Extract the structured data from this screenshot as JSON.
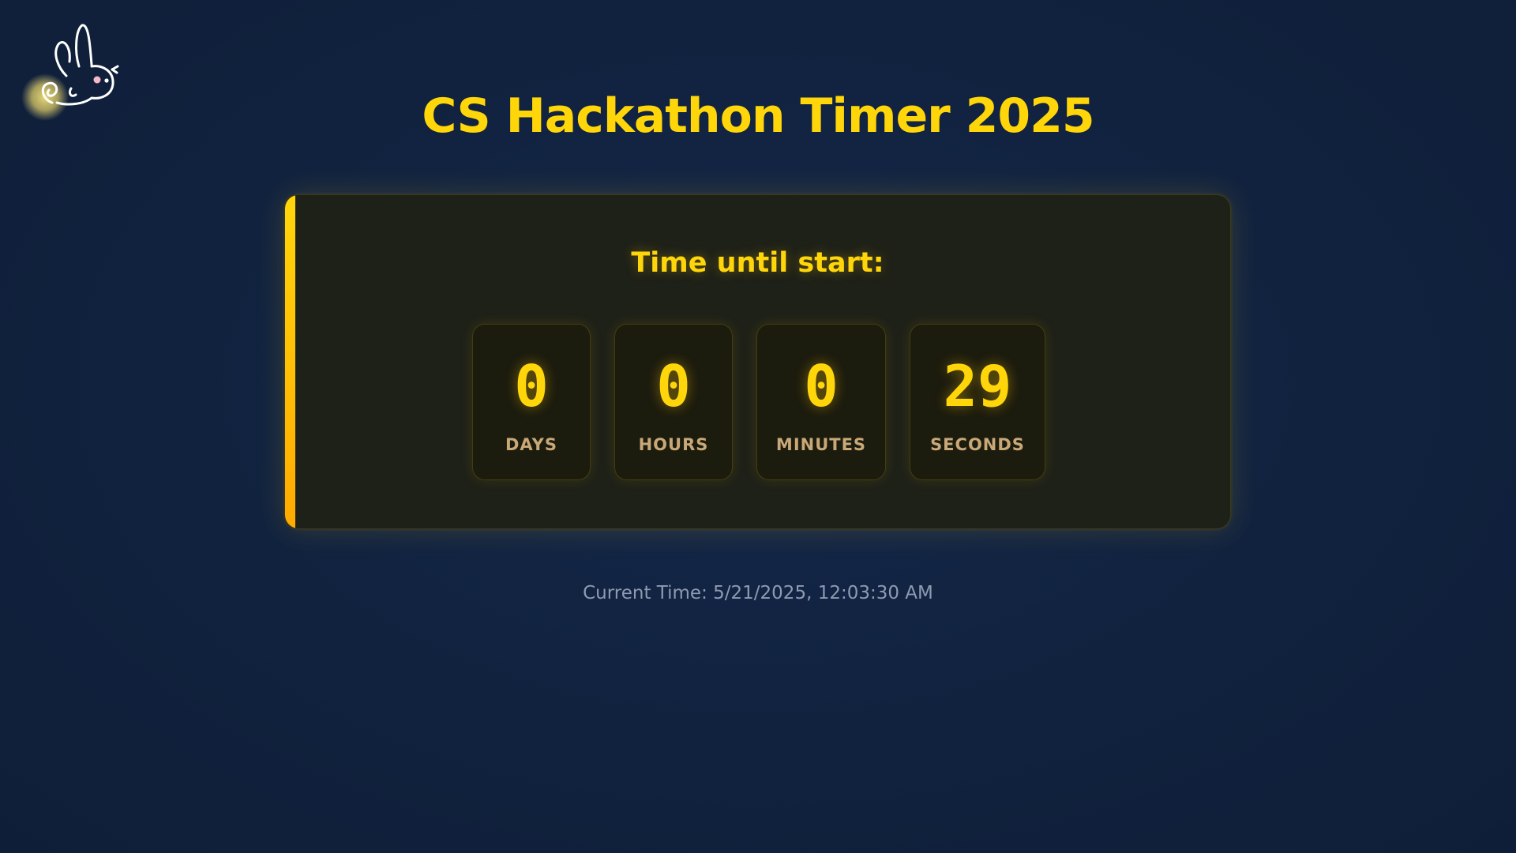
{
  "logo": {
    "icon": "bunny-logo-icon",
    "glow_color": "#f0e070"
  },
  "header": {
    "title": "CS Hackathon Timer 2025"
  },
  "timer": {
    "heading": "Time until start:",
    "units": [
      {
        "value": "0",
        "label": "DAYS"
      },
      {
        "value": "0",
        "label": "HOURS"
      },
      {
        "value": "0",
        "label": "MINUTES"
      },
      {
        "value": "29",
        "label": "SECONDS"
      }
    ]
  },
  "footer": {
    "current_time_label": "Current Time:",
    "current_time_value": "5/21/2025, 12:03:30 AM"
  },
  "colors": {
    "accent": "#ffd60a",
    "accent_gradient_end": "#ffaa00",
    "background": "#112340",
    "label": "#c9a878",
    "muted_text": "#8e9ab0"
  }
}
